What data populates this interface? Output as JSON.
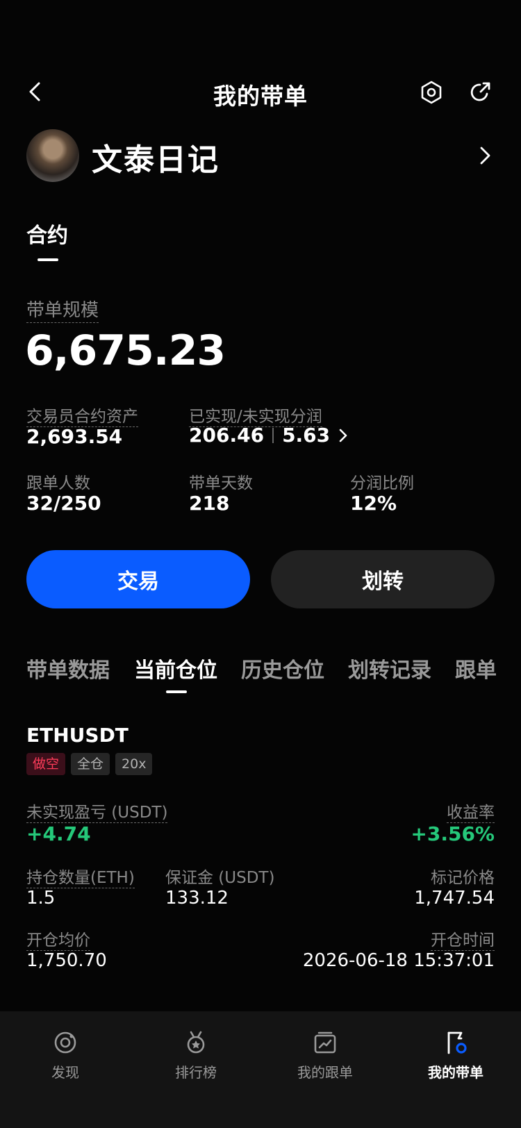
{
  "header": {
    "title": "我的带单",
    "back_icon": "chevron-left-icon",
    "settings_icon": "hexagon-settings-icon",
    "share_icon": "share-icon"
  },
  "profile": {
    "name": "文泰日记"
  },
  "section_tab": "合约",
  "scale": {
    "label": "带单规模",
    "value": "6,675.23"
  },
  "stats": {
    "trader_assets_label": "交易员合约资产",
    "trader_assets_value": "2,693.54",
    "pnl_label": "已实现/未实现分润",
    "realized": "206.46",
    "unrealized": "5.63",
    "followers_label": "跟单人数",
    "followers_value": "32/250",
    "days_label": "带单天数",
    "days_value": "218",
    "share_ratio_label": "分润比例",
    "share_ratio_value": "12%"
  },
  "buttons": {
    "trade": "交易",
    "transfer": "划转"
  },
  "tabs": [
    {
      "label": "带单数据"
    },
    {
      "label": "当前仓位"
    },
    {
      "label": "历史仓位"
    },
    {
      "label": "划转记录"
    },
    {
      "label": "跟单"
    }
  ],
  "position": {
    "symbol": "ETHUSDT",
    "badges": [
      "做空",
      "全仓",
      "20x"
    ],
    "unrealized_label": "未实现盈亏 (USDT)",
    "unrealized_value": "+4.74",
    "roi_label": "收益率",
    "roi_value": "+3.56%",
    "qty_label": "持仓数量(ETH)",
    "qty_value": "1.5",
    "margin_label": "保证金 (USDT)",
    "margin_value": "133.12",
    "mark_price_label": "标记价格",
    "mark_price_value": "1,747.54",
    "entry_label": "开仓均价",
    "entry_value": "1,750.70",
    "open_time_label": "开仓时间",
    "open_time_value": "2026-06-18 15:37:01"
  },
  "colors": {
    "accent_blue": "#0a5cff",
    "profit_green": "#25c87a",
    "short_red": "#ff3c5a",
    "background": "#050505"
  },
  "bottom_nav": [
    {
      "label": "发现",
      "icon": "discover-icon"
    },
    {
      "label": "排行榜",
      "icon": "medal-icon"
    },
    {
      "label": "我的跟单",
      "icon": "chart-card-icon"
    },
    {
      "label": "我的带单",
      "icon": "flag-badge-icon"
    }
  ]
}
